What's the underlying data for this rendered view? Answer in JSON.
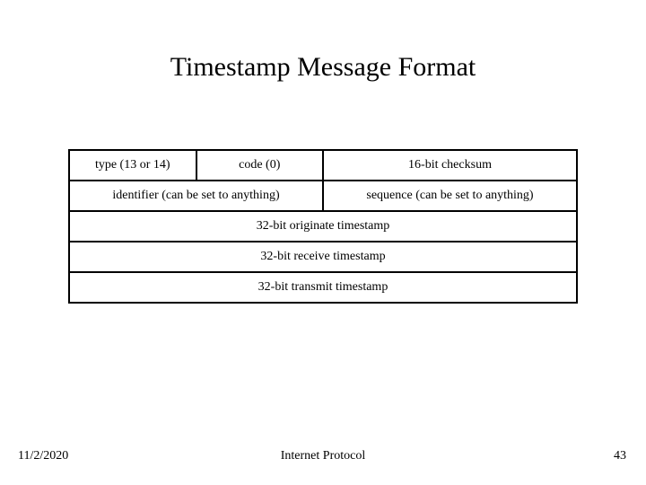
{
  "title": "Timestamp Message Format",
  "table": {
    "r1": {
      "type": "type (13 or 14)",
      "code": "code (0)",
      "checksum": "16-bit checksum"
    },
    "r2": {
      "identifier": "identifier (can be set to anything)",
      "sequence": "sequence (can be set to anything)"
    },
    "r3": "32-bit originate timestamp",
    "r4": "32-bit receive timestamp",
    "r5": "32-bit transmit timestamp"
  },
  "footer": {
    "date": "11/2/2020",
    "subject": "Internet Protocol",
    "page": "43"
  }
}
